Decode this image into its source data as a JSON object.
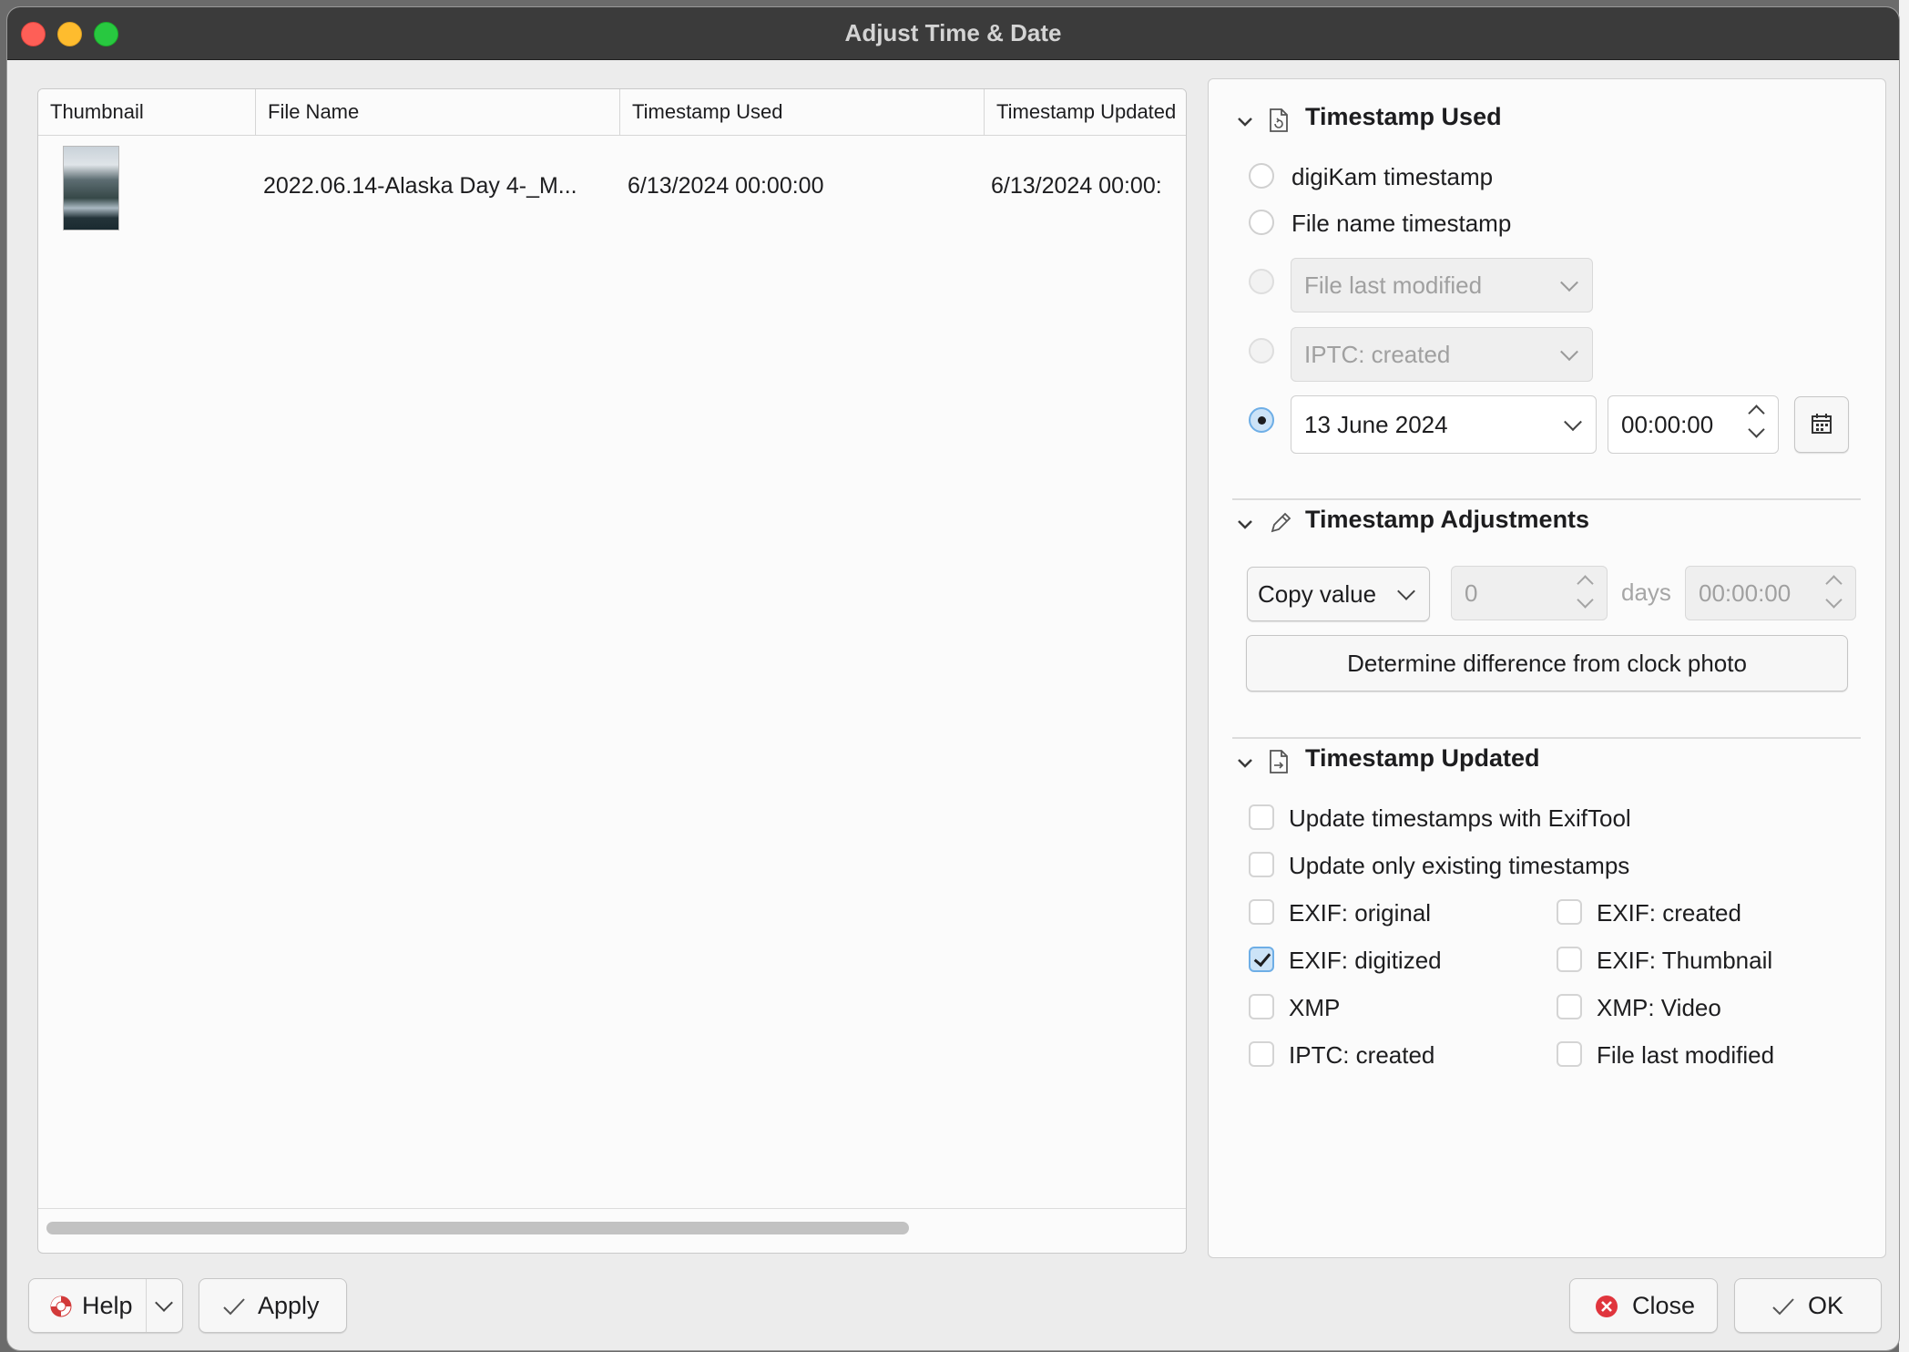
{
  "window": {
    "title": "Adjust Time & Date"
  },
  "table": {
    "columns": [
      "Thumbnail",
      "File Name",
      "Timestamp Used",
      "Timestamp Updated"
    ],
    "rows": [
      {
        "file_name": "2022.06.14-Alaska Day 4-_M...",
        "timestamp_used": "6/13/2024 00:00:00",
        "timestamp_updated": "6/13/2024 00:00:"
      }
    ]
  },
  "timestamp_used": {
    "title": "Timestamp Used",
    "options": {
      "digikam": "digiKam timestamp",
      "filename": "File name timestamp",
      "file_modified_combo": "File last modified",
      "metadata_combo": "IPTC: created",
      "custom_date": "13 June 2024",
      "custom_time": "00:00:00"
    },
    "selected": "custom"
  },
  "timestamp_adjustments": {
    "title": "Timestamp Adjustments",
    "mode": "Copy value",
    "days_value": "0",
    "days_label": "days",
    "time_value": "00:00:00",
    "clock_photo_button": "Determine difference from clock photo"
  },
  "timestamp_updated": {
    "title": "Timestamp Updated",
    "checkboxes": {
      "exiftool": {
        "label": "Update timestamps with ExifTool",
        "checked": false
      },
      "existing_only": {
        "label": "Update only existing timestamps",
        "checked": false
      },
      "exif_original": {
        "label": "EXIF: original",
        "checked": false
      },
      "exif_created": {
        "label": "EXIF: created",
        "checked": false
      },
      "exif_digitized": {
        "label": "EXIF: digitized",
        "checked": true
      },
      "exif_thumbnail": {
        "label": "EXIF: Thumbnail",
        "checked": false
      },
      "xmp": {
        "label": "XMP",
        "checked": false
      },
      "xmp_video": {
        "label": "XMP: Video",
        "checked": false
      },
      "iptc_created": {
        "label": "IPTC: created",
        "checked": false
      },
      "file_last_modified": {
        "label": "File last modified",
        "checked": false
      }
    }
  },
  "footer": {
    "help": "Help",
    "apply": "Apply",
    "close": "Close",
    "ok": "OK"
  },
  "colors": {
    "titlebar": "#3b3b3b",
    "accent_check": "#cce3f7",
    "close_red": "#e0353d"
  }
}
